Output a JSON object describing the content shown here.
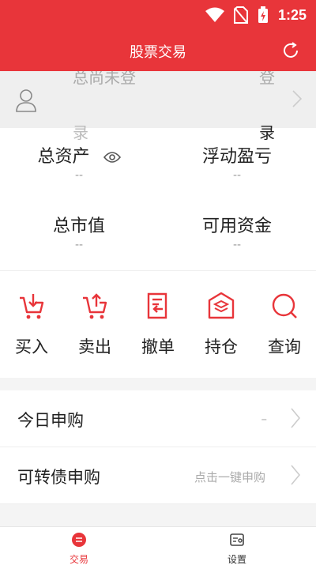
{
  "status": {
    "time": "1:25"
  },
  "header": {
    "title": "股票交易"
  },
  "login": {
    "ghost_left_top": "总尚未登",
    "ghost_right_top": "登",
    "ghost_left_bottom": "录",
    "ghost_right_bottom": "录"
  },
  "assets": {
    "total_assets": {
      "label": "总资产",
      "value": "--"
    },
    "floating_pl": {
      "label": "浮动盈亏",
      "value": "--"
    },
    "market_value": {
      "label": "总市值",
      "value": "--"
    },
    "available_funds": {
      "label": "可用资金",
      "value": "--"
    }
  },
  "actions": [
    {
      "label": "买入",
      "icon": "cart-buy-icon"
    },
    {
      "label": "卖出",
      "icon": "cart-sell-icon"
    },
    {
      "label": "撤单",
      "icon": "cancel-order-icon"
    },
    {
      "label": "持仓",
      "icon": "holdings-icon"
    },
    {
      "label": "查询",
      "icon": "search-icon"
    }
  ],
  "menu": [
    {
      "label": "今日申购",
      "right": "–"
    },
    {
      "label": "可转债申购",
      "right": "点击一键申购"
    }
  ],
  "tabs": [
    {
      "label": "交易",
      "icon": "trade-icon",
      "active": true
    },
    {
      "label": "设置",
      "icon": "settings-icon",
      "active": false
    }
  ],
  "colors": {
    "accent": "#e8353a"
  }
}
